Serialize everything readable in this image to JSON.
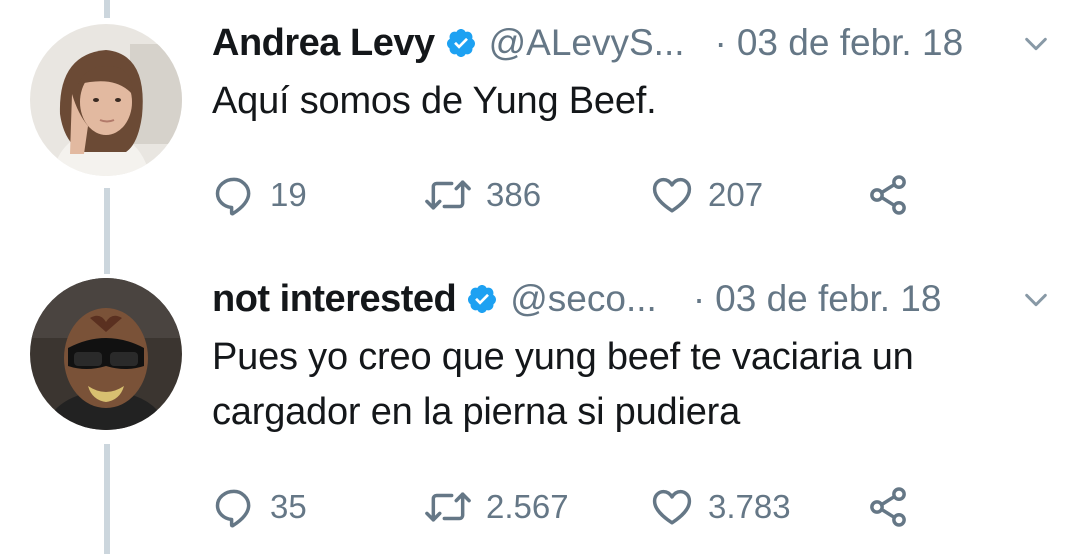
{
  "tweets": [
    {
      "name": "Andrea Levy",
      "handle": "@ALevyS...",
      "separator": "·",
      "date": "03 de febr. 18",
      "text": "Aquí somos de Yung Beef.",
      "replies": "19",
      "retweets": "386",
      "likes": "207"
    },
    {
      "name": "not interested",
      "handle": "@seco...",
      "separator": "·",
      "date": "03 de febr. 18",
      "text": "Pues yo creo que yung beef te vaciaria un cargador en la pierna si pudiera",
      "replies": "35",
      "retweets": "2.567",
      "likes": "3.783"
    }
  ],
  "colors": {
    "verified": "#1da1f2",
    "secondary_text": "#657786",
    "thread_line": "#ccd6dd"
  }
}
